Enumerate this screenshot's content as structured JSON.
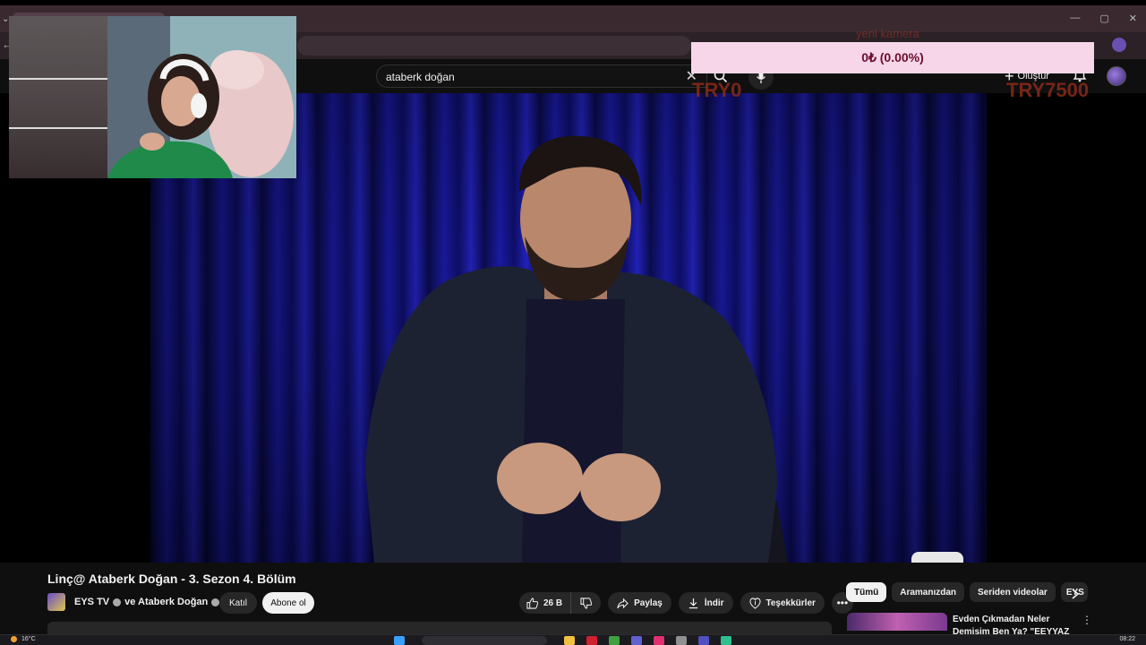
{
  "search": {
    "query": "ataberk doğan"
  },
  "header": {
    "create_label": "Oluştur"
  },
  "overlay": {
    "donation_text": "0₺ (0.00%)",
    "camera_label": "yeni kamera",
    "try_left": "TRY0",
    "try_right": "TRY7500"
  },
  "video": {
    "title": "Linç@ Ataberk Doğan - 3. Sezon 4. Bölüm",
    "channel_name": "EYS TV",
    "channel_joiner": "ve Ataberk Doğan",
    "join_label": "Katıl",
    "subscribe_label": "Abone ol",
    "like_count": "26 B",
    "share_label": "Paylaş",
    "download_label": "İndir",
    "thanks_label": "Teşekkürler"
  },
  "sidebar": {
    "chips": [
      "Tümü",
      "Aramanızdan",
      "Seriden videolar",
      "EYS"
    ],
    "rec_title": "Evden Çıkmadan Neler Demişim Ben Ya? \"EEYYAZ YİĞİT\" -"
  },
  "taskbar": {
    "weather": "16°C",
    "clock": "08:22"
  },
  "colors": {
    "background": "#0f0f0f",
    "donation_bg": "#f7d6ea",
    "subscribe_bg": "#f1f1f1",
    "curtain_blue": "#1a1aa8"
  }
}
